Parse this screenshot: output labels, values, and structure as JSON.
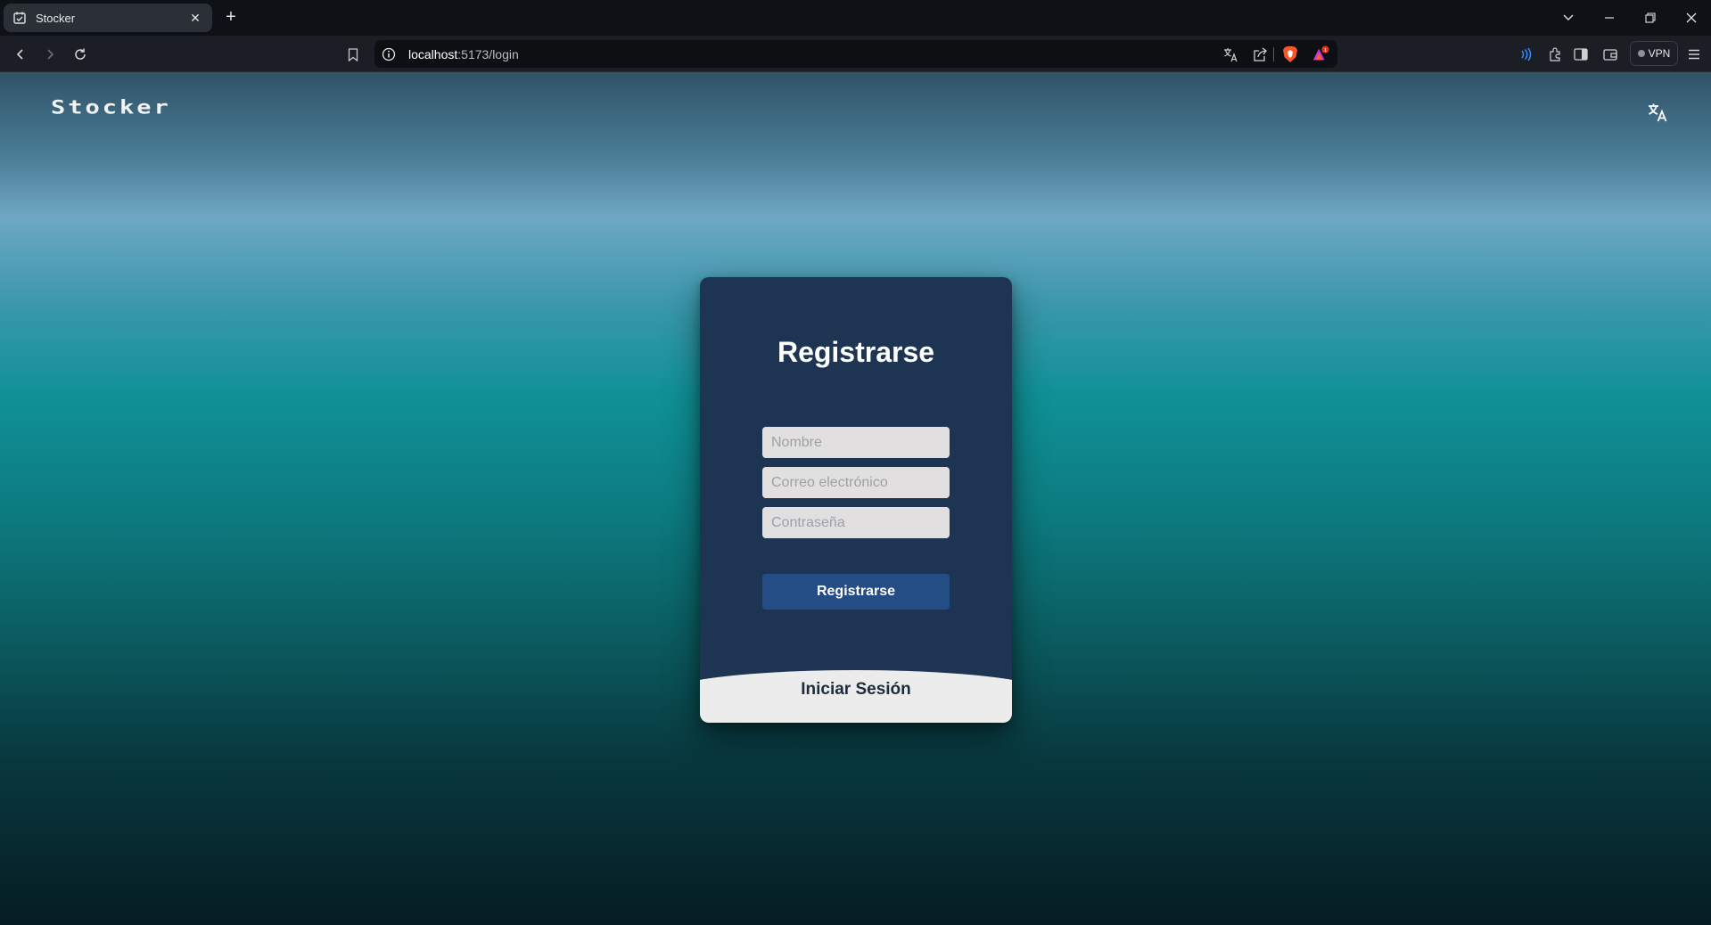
{
  "browser": {
    "tab": {
      "title": "Stocker",
      "favicon": "calendar-check-icon",
      "close_icon": "close-icon"
    },
    "new_tab_icon": "plus-icon",
    "window_controls": [
      "chevron-down-icon",
      "minimize-icon",
      "restore-icon",
      "close-icon"
    ],
    "nav": [
      "back-icon",
      "forward-icon",
      "reload-icon"
    ],
    "address": {
      "host": "localhost",
      "path": ":5173/login",
      "info_icon": "info-icon",
      "bookmark_icon": "bookmark-icon"
    },
    "address_right_icons": [
      "translate-icon",
      "share-icon",
      "brave-shields-icon",
      "brave-rewards-icon"
    ],
    "toolbar_icons": [
      "leo-ai-icon",
      "extensions-icon",
      "sidebar-icon",
      "wallet-icon",
      "menu-icon"
    ],
    "vpn_label": "VPN"
  },
  "page": {
    "brand": "Stocker",
    "language_icon": "translate-icon",
    "form": {
      "title": "Registrarse",
      "fields": {
        "name": {
          "placeholder": "Nombre",
          "value": ""
        },
        "email": {
          "placeholder": "Correo electrónico",
          "value": ""
        },
        "password": {
          "placeholder": "Contraseña",
          "value": ""
        }
      },
      "submit_label": "Registrarse",
      "switch_label": "Iniciar Sesión"
    }
  },
  "colors": {
    "card": "#1d3552",
    "button": "#244c85",
    "switch_panel": "#edeced",
    "input": "#e2dfe1"
  }
}
